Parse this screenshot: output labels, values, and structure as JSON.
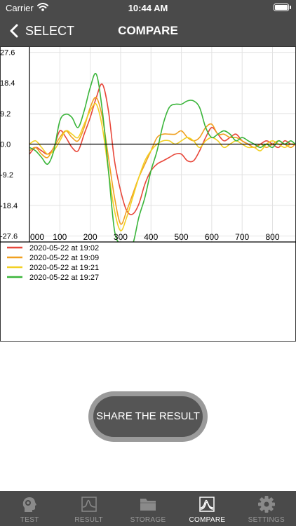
{
  "status_bar": {
    "carrier": "Carrier",
    "time": "10:44 AM"
  },
  "nav": {
    "back_label": "SELECT",
    "title": "COMPARE"
  },
  "chart_data": {
    "type": "line",
    "title": "",
    "xlabel": "",
    "ylabel": "",
    "x_ticks": [
      "000",
      "100",
      "200",
      "300",
      "400",
      "500",
      "600",
      "700",
      "800"
    ],
    "y_ticks": [
      "27.6",
      "18.4",
      "9.2",
      "0.0",
      "-9.2",
      "-18.4",
      "-27.6"
    ],
    "xlim": [
      0,
      875
    ],
    "ylim": [
      -29.4,
      29.2
    ],
    "legend_position": "bottom-left",
    "series": [
      {
        "name": "2020-05-22 at 19:02",
        "color": "#e8473a",
        "x": [
          0,
          20,
          40,
          60,
          80,
          100,
          120,
          140,
          160,
          180,
          200,
          220,
          240,
          260,
          280,
          300,
          320,
          340,
          360,
          380,
          400,
          420,
          440,
          460,
          480,
          500,
          520,
          540,
          560,
          580,
          600,
          620,
          640,
          660,
          680,
          700,
          720,
          740,
          760,
          780,
          800,
          820,
          840,
          860,
          875
        ],
        "y": [
          -3,
          -1,
          -2,
          -3,
          -1,
          4,
          2,
          -1,
          -2,
          3,
          8,
          14,
          18,
          10,
          -5,
          -14,
          -20,
          -21,
          -18,
          -12,
          -8,
          -6,
          -5,
          -4,
          -3,
          -3,
          -5,
          -5,
          -2,
          2,
          5,
          3,
          1,
          2,
          3,
          1,
          0,
          -1,
          0,
          1,
          0,
          -1,
          1,
          0,
          0
        ]
      },
      {
        "name": "2020-05-22 at 19:09",
        "color": "#f0a020",
        "x": [
          0,
          20,
          40,
          60,
          80,
          100,
          120,
          140,
          160,
          180,
          200,
          220,
          240,
          260,
          280,
          300,
          320,
          340,
          360,
          380,
          400,
          420,
          440,
          460,
          480,
          500,
          520,
          540,
          560,
          580,
          600,
          620,
          640,
          660,
          680,
          700,
          720,
          740,
          760,
          780,
          800,
          820,
          840,
          860,
          875
        ],
        "y": [
          -2,
          -1,
          -3,
          -4,
          -1,
          2,
          4,
          2,
          1,
          5,
          11,
          14,
          8,
          -4,
          -16,
          -24,
          -20,
          -15,
          -10,
          -6,
          -2,
          2,
          3,
          3,
          3,
          4,
          2,
          1,
          2,
          5,
          6,
          3,
          3,
          2,
          2,
          1,
          0,
          -1,
          0,
          -1,
          0,
          1,
          0,
          -1,
          0
        ]
      },
      {
        "name": "2020-05-22 at 19:21",
        "color": "#f2d024",
        "x": [
          0,
          20,
          40,
          60,
          80,
          100,
          120,
          140,
          160,
          180,
          200,
          220,
          240,
          260,
          280,
          300,
          320,
          340,
          360,
          380,
          400,
          420,
          440,
          460,
          480,
          500,
          520,
          540,
          560,
          580,
          600,
          620,
          640,
          660,
          680,
          700,
          720,
          740,
          760,
          780,
          800,
          820,
          840,
          860,
          875
        ],
        "y": [
          0,
          1,
          -1,
          -3,
          -2,
          1,
          4,
          3,
          2,
          6,
          10,
          12,
          5,
          -8,
          -20,
          -26,
          -22,
          -16,
          -10,
          -5,
          -2,
          0,
          1,
          1,
          0,
          1,
          2,
          1,
          -1,
          1,
          2,
          1,
          -1,
          0,
          1,
          0,
          -1,
          -1,
          -2,
          0,
          1,
          0,
          -1,
          0,
          0
        ]
      },
      {
        "name": "2020-05-22 at 19:27",
        "color": "#3ab53a",
        "x": [
          0,
          20,
          40,
          60,
          80,
          100,
          120,
          140,
          160,
          180,
          200,
          220,
          240,
          260,
          280,
          300,
          320,
          340,
          360,
          380,
          400,
          420,
          440,
          460,
          480,
          500,
          520,
          540,
          560,
          580,
          600,
          620,
          640,
          660,
          680,
          700,
          720,
          740,
          760,
          780,
          800,
          820,
          840,
          860,
          875
        ],
        "y": [
          -1,
          -2,
          -4,
          -6,
          -2,
          7,
          9,
          8,
          5,
          10,
          17,
          21,
          10,
          -8,
          -26,
          -30,
          -30,
          -30,
          -22,
          -16,
          -8,
          -2,
          6,
          11,
          12,
          12,
          13,
          13,
          11,
          5,
          2,
          3,
          4,
          3,
          1,
          2,
          1,
          0,
          -1,
          0,
          -1,
          1,
          0,
          1,
          0
        ]
      }
    ]
  },
  "share_button": {
    "label": "SHARE THE RESULT"
  },
  "tabs": [
    {
      "label": "TEST",
      "icon": "head-icon",
      "active": false
    },
    {
      "label": "RESULT",
      "icon": "waveform-icon",
      "active": false
    },
    {
      "label": "STORAGE",
      "icon": "folder-icon",
      "active": false
    },
    {
      "label": "COMPARE",
      "icon": "compare-waveform-icon",
      "active": true
    },
    {
      "label": "SETTINGS",
      "icon": "gear-icon",
      "active": false
    }
  ]
}
